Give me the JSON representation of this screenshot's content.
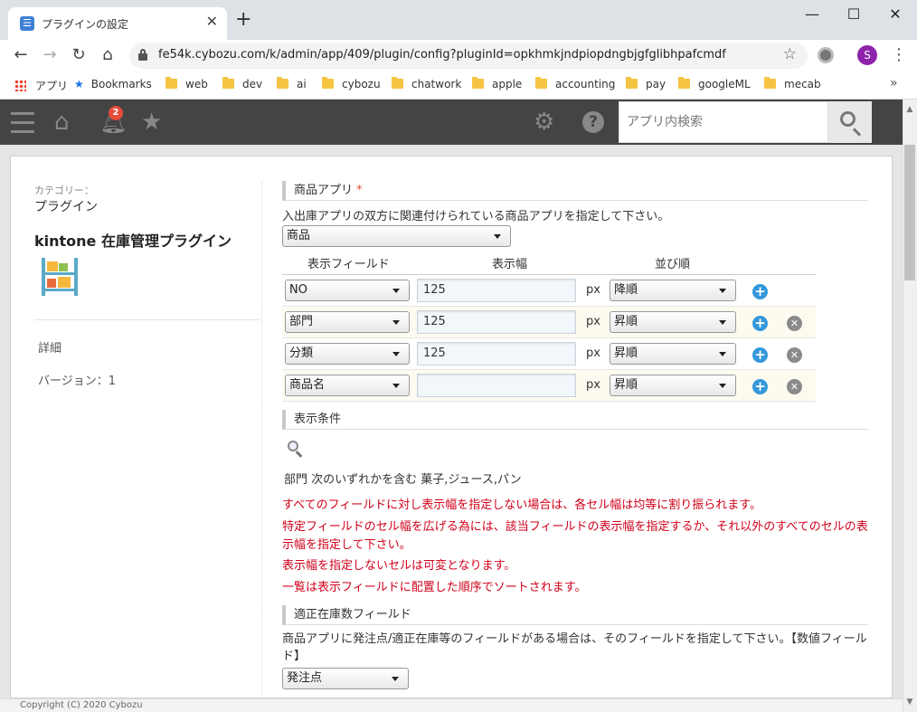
{
  "browser": {
    "tab_title": "プラグインの設定",
    "url": "fe54k.cybozu.com/k/admin/app/409/plugin/config?pluginId=opkhmkjndpiopdngbjgfglibhpafcmdf",
    "profile_initial": "S",
    "bookmarks": [
      "アプリ",
      "Bookmarks",
      "web",
      "dev",
      "ai",
      "cybozu",
      "chatwork",
      "apple",
      "accounting",
      "pay",
      "googleML",
      "mecab"
    ]
  },
  "header": {
    "notification_count": "2",
    "search_placeholder": "アプリ内検索"
  },
  "sidebar": {
    "category_label": "カテゴリー：",
    "category_value": "プラグイン",
    "plugin_name": "kintone 在庫管理プラグイン",
    "detail_label": "詳細",
    "version_label": "バージョン：1"
  },
  "main": {
    "product_app": {
      "title": "商品アプリ",
      "required_mark": "*",
      "description": "入出庫アプリの双方に関連付けられている商品アプリを指定して下さい。",
      "selected": "商品"
    },
    "table": {
      "headers": [
        "表示フィールド",
        "表示幅",
        "並び順"
      ],
      "unit": "px",
      "rows": [
        {
          "field": "NO",
          "width": "125",
          "order": "降順"
        },
        {
          "field": "部門",
          "width": "125",
          "order": "昇順"
        },
        {
          "field": "分類",
          "width": "125",
          "order": "昇順"
        },
        {
          "field": "商品名",
          "width": "",
          "order": "昇順"
        }
      ]
    },
    "display_condition": {
      "title": "表示条件",
      "condition": "部門 次のいずれかを含む 菓子,ジュース,パン"
    },
    "notes": [
      "すべてのフィールドに対し表示幅を指定しない場合は、各セル幅は均等に割り振られます。",
      "特定フィールドのセル幅を広げる為には、該当フィールドの表示幅を指定するか、それ以外のすべてのセルの表示幅を指定して下さい。",
      "表示幅を指定しないセルは可変となります。",
      "一覧は表示フィールドに配置した順序でソートされます。"
    ],
    "stock_field": {
      "title": "適正在庫数フィールド",
      "description": "商品アプリに発注点/適正在庫等のフィールドがある場合は、そのフィールドを指定して下さい。【数値フィールド】",
      "selected": "発注点"
    }
  },
  "footer": {
    "copyright": "Copyright (C) 2020 Cybozu"
  }
}
